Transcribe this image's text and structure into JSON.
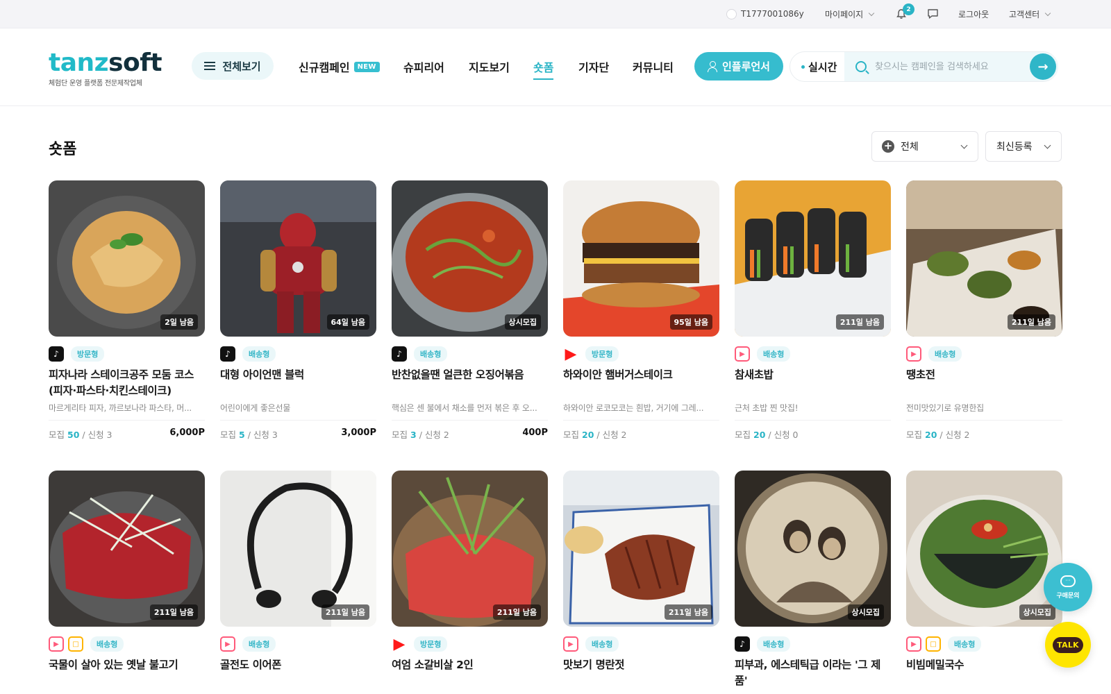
{
  "topbar": {
    "user_id": "T1777001086y",
    "mypage": "마이페이지",
    "notification_count": "2",
    "logout": "로그아웃",
    "customer_center": "고객센터"
  },
  "header": {
    "logo_part1": "tanz",
    "logo_part2": "soft",
    "logo_sub": "체험단 운영 플랫폼 전문제작업체",
    "all_view": "전체보기",
    "nav": [
      "신규캠페인",
      "슈피리어",
      "지도보기",
      "숏폼",
      "기자단",
      "커뮤니티"
    ],
    "new_badge": "NEW",
    "influencer": "인플루언서",
    "realtime": "실시간",
    "search_placeholder": "찾으시는 캠페인을 검색하세요",
    "search_value": ""
  },
  "section": {
    "title": "숏폼",
    "filter_all": "전체",
    "filter_sort": "최신등록"
  },
  "colors": {
    "accent": "#2ab4c6",
    "kakao": "#fee500"
  },
  "cards": [
    {
      "days": "2일 남음",
      "platforms": [
        "tiktok"
      ],
      "type": "방문형",
      "title": "피자나라 스테이크공주 모둠 코스(피자·파스타·치킨스테이크)",
      "desc": "마르게리타 피자, 까르보나라 파스타, 머...",
      "recruit_label": "모집",
      "recruit": "50",
      "apply": "/ 신청 3",
      "points": "6,000P"
    },
    {
      "days": "64일 남음",
      "platforms": [
        "tiktok"
      ],
      "type": "배송형",
      "title": "대형 아이언맨 블럭",
      "desc": "어린이에게 좋은선물",
      "recruit_label": "모집",
      "recruit": "5",
      "apply": "/ 신청 3",
      "points": "3,000P"
    },
    {
      "days": "상시모집",
      "platforms": [
        "tiktok"
      ],
      "type": "배송형",
      "title": "반찬없을땐 얼큰한 오징어볶음",
      "desc": "핵심은 센 불에서 채소를 먼저 볶은 후 오...",
      "recruit_label": "모집",
      "recruit": "3",
      "apply": "/ 신청 2",
      "points": "400P"
    },
    {
      "days": "95일 남음",
      "platforms": [
        "shorts"
      ],
      "type": "방문형",
      "title": "하와이안 햄버거스테이크",
      "desc": "하와이안 로코모코는 흰밥, 거기에 그레...",
      "recruit_label": "모집",
      "recruit": "20",
      "apply": "/ 신청 2",
      "points": ""
    },
    {
      "days": "211일 남음",
      "platforms": [
        "reels"
      ],
      "type": "배송형",
      "title": "참새초밥",
      "desc": "근처 초밥 찐 맛집!",
      "recruit_label": "모집",
      "recruit": "20",
      "apply": "/ 신청 0",
      "points": ""
    },
    {
      "days": "211일 남음",
      "platforms": [
        "reels"
      ],
      "type": "배송형",
      "title": "땡초전",
      "desc": "전미맛있기로 유명한집",
      "recruit_label": "모집",
      "recruit": "20",
      "apply": "/ 신청 2",
      "points": ""
    },
    {
      "days": "211일 남음",
      "platforms": [
        "reels",
        "clip"
      ],
      "type": "배송형",
      "title": "국물이 살아 있는 옛날 불고기",
      "desc": "",
      "recruit_label": "",
      "recruit": "",
      "apply": "",
      "points": ""
    },
    {
      "days": "211일 남음",
      "platforms": [
        "reels"
      ],
      "type": "배송형",
      "title": "골전도 이어폰",
      "desc": "",
      "recruit_label": "",
      "recruit": "",
      "apply": "",
      "points": ""
    },
    {
      "days": "211일 남음",
      "platforms": [
        "shorts"
      ],
      "type": "방문형",
      "title": "여엄 소갈비살 2인",
      "desc": "",
      "recruit_label": "",
      "recruit": "",
      "apply": "",
      "points": ""
    },
    {
      "days": "211일 남음",
      "platforms": [
        "reels"
      ],
      "type": "배송형",
      "title": "맛보기 명란젓",
      "desc": "",
      "recruit_label": "",
      "recruit": "",
      "apply": "",
      "points": ""
    },
    {
      "days": "상시모집",
      "platforms": [
        "tiktok"
      ],
      "type": "배송형",
      "title": "피부과, 에스테틱급 이라는 '그 제품'",
      "desc": "",
      "recruit_label": "",
      "recruit": "",
      "apply": "",
      "points": ""
    },
    {
      "days": "상시모집",
      "platforms": [
        "reels",
        "clip"
      ],
      "type": "배송형",
      "title": "비빔메밀국수",
      "desc": "",
      "recruit_label": "",
      "recruit": "",
      "apply": "",
      "points": ""
    }
  ],
  "floating": {
    "ask_label": "구매문의",
    "talk_label": "TALK"
  }
}
